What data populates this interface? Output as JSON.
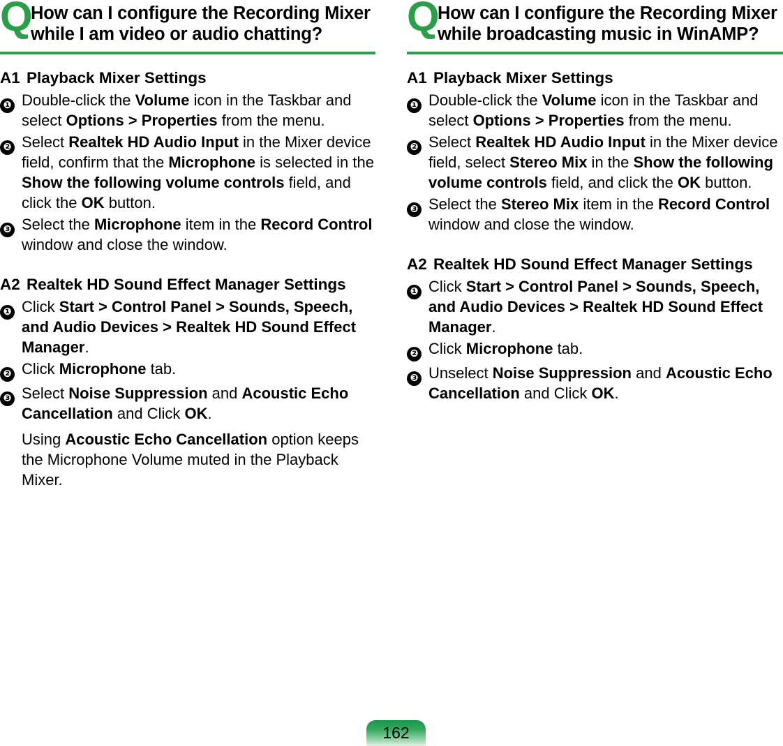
{
  "page": {
    "number": "162",
    "q_symbol": "Q",
    "accent_green": "#2b9e49",
    "badge_green": "#16964a"
  },
  "columns": [
    {
      "question": "How can I configure the Recording Mixer while I am video or audio chatting?",
      "answers": [
        {
          "tag": "A1",
          "title": "Playback Mixer Settings",
          "steps": [
            {
              "num": "❶",
              "runs": [
                {
                  "text": "Double-click the ",
                  "bold": false
                },
                {
                  "text": "Volume",
                  "bold": true
                },
                {
                  "text": " icon in the Taskbar and select ",
                  "bold": false
                },
                {
                  "text": "Options > Properties",
                  "bold": true
                },
                {
                  "text": " from the menu.",
                  "bold": false
                }
              ]
            },
            {
              "num": "❷",
              "runs": [
                {
                  "text": "Select ",
                  "bold": false
                },
                {
                  "text": "Realtek HD Audio Input",
                  "bold": true
                },
                {
                  "text": " in the Mixer device field, confirm that the ",
                  "bold": false
                },
                {
                  "text": "Microphone",
                  "bold": true
                },
                {
                  "text": " is selected in the ",
                  "bold": false
                },
                {
                  "text": "Show the following volume controls",
                  "bold": true
                },
                {
                  "text": " field, and click the ",
                  "bold": false
                },
                {
                  "text": "OK",
                  "bold": true
                },
                {
                  "text": " button.",
                  "bold": false
                }
              ]
            },
            {
              "num": "❸",
              "runs": [
                {
                  "text": "Select the ",
                  "bold": false
                },
                {
                  "text": "Microphone",
                  "bold": true
                },
                {
                  "text": " item in the ",
                  "bold": false
                },
                {
                  "text": "Record Control",
                  "bold": true
                },
                {
                  "text": " window and close the window.",
                  "bold": false
                }
              ]
            }
          ],
          "note": null
        },
        {
          "tag": "A2",
          "title": "Realtek HD Sound Effect Manager Settings",
          "steps": [
            {
              "num": "❶",
              "runs": [
                {
                  "text": "Click ",
                  "bold": false
                },
                {
                  "text": "Start > Control Panel > Sounds, Speech, and Audio Devices > Realtek HD Sound Effect Manager",
                  "bold": true
                },
                {
                  "text": ".",
                  "bold": false
                }
              ]
            },
            {
              "num": "❷",
              "runs": [
                {
                  "text": "Click ",
                  "bold": false
                },
                {
                  "text": "Microphone",
                  "bold": true
                },
                {
                  "text": " tab.",
                  "bold": false
                }
              ]
            },
            {
              "num": "❸",
              "runs": [
                {
                  "text": "Select ",
                  "bold": false
                },
                {
                  "text": "Noise Suppression",
                  "bold": true
                },
                {
                  "text": " and ",
                  "bold": false
                },
                {
                  "text": "Acoustic Echo Cancellation",
                  "bold": true
                },
                {
                  "text": " and Click ",
                  "bold": false
                },
                {
                  "text": "OK",
                  "bold": true
                },
                {
                  "text": ".",
                  "bold": false
                }
              ]
            }
          ],
          "note": {
            "runs": [
              {
                "text": "Using ",
                "bold": false
              },
              {
                "text": "Acoustic Echo Cancellation",
                "bold": true
              },
              {
                "text": " option keeps the Microphone Volume muted in the Playback Mixer.",
                "bold": false
              }
            ]
          }
        }
      ]
    },
    {
      "question": "How can I configure the Recording Mixer while broadcasting music in WinAMP?",
      "answers": [
        {
          "tag": "A1",
          "title": "Playback Mixer Settings",
          "steps": [
            {
              "num": "❶",
              "runs": [
                {
                  "text": "Double-click the ",
                  "bold": false
                },
                {
                  "text": "Volume",
                  "bold": true
                },
                {
                  "text": " icon in the Taskbar and select ",
                  "bold": false
                },
                {
                  "text": "Options > Properties",
                  "bold": true
                },
                {
                  "text": " from the menu.",
                  "bold": false
                }
              ]
            },
            {
              "num": "❷",
              "runs": [
                {
                  "text": "Select ",
                  "bold": false
                },
                {
                  "text": "Realtek HD Audio Input",
                  "bold": true
                },
                {
                  "text": " in the Mixer device field, select  ",
                  "bold": false
                },
                {
                  "text": "Stereo Mix",
                  "bold": true
                },
                {
                  "text": " in the ",
                  "bold": false
                },
                {
                  "text": "Show the following volume controls",
                  "bold": true
                },
                {
                  "text": " field, and click the ",
                  "bold": false
                },
                {
                  "text": "OK",
                  "bold": true
                },
                {
                  "text": " button.",
                  "bold": false
                }
              ]
            },
            {
              "num": "❸",
              "runs": [
                {
                  "text": "Select the ",
                  "bold": false
                },
                {
                  "text": "Stereo Mix",
                  "bold": true
                },
                {
                  "text": " item in the ",
                  "bold": false
                },
                {
                  "text": "Record Control",
                  "bold": true
                },
                {
                  "text": " window and close the window.",
                  "bold": false
                }
              ]
            }
          ],
          "note": null
        },
        {
          "tag": "A2",
          "title": "Realtek HD Sound Effect Manager Settings",
          "steps": [
            {
              "num": "❶",
              "runs": [
                {
                  "text": "Click ",
                  "bold": false
                },
                {
                  "text": "Start > Control Panel > Sounds, Speech, and Audio Devices > Realtek HD Sound Effect Manager",
                  "bold": true
                },
                {
                  "text": ".",
                  "bold": false
                }
              ]
            },
            {
              "num": "❷",
              "runs": [
                {
                  "text": "Click ",
                  "bold": false
                },
                {
                  "text": "Microphone",
                  "bold": true
                },
                {
                  "text": " tab.",
                  "bold": false
                }
              ]
            },
            {
              "num": "❸",
              "runs": [
                {
                  "text": "Unselect ",
                  "bold": false
                },
                {
                  "text": "Noise Suppression",
                  "bold": true
                },
                {
                  "text": " and ",
                  "bold": false
                },
                {
                  "text": "Acoustic Echo Cancellation",
                  "bold": true
                },
                {
                  "text": " and Click ",
                  "bold": false
                },
                {
                  "text": "OK",
                  "bold": true
                },
                {
                  "text": ".",
                  "bold": false
                }
              ]
            }
          ],
          "note": null
        }
      ]
    }
  ]
}
